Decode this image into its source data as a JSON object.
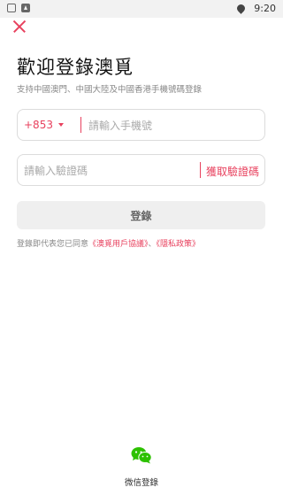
{
  "status_bar": {
    "time": "9:20"
  },
  "title": "歡迎登錄澳覓",
  "subtitle": "支持中國澳門、中國大陸及中國香港手機號碼登錄",
  "phone": {
    "country_code": "+853",
    "placeholder": "請輸入手機號",
    "value": ""
  },
  "code": {
    "placeholder": "請輸入驗證碼",
    "value": "",
    "get_code_label": "獲取驗證碼"
  },
  "login_button": "登錄",
  "agreement": {
    "prefix": "登錄即代表您已同意",
    "user_agreement": "《澳覓用戶協議》",
    "separator": "、",
    "privacy_policy": "《隱私政策》"
  },
  "wechat": {
    "label": "微信登錄"
  },
  "colors": {
    "accent": "#e8415e",
    "wechat": "#2dc100"
  }
}
